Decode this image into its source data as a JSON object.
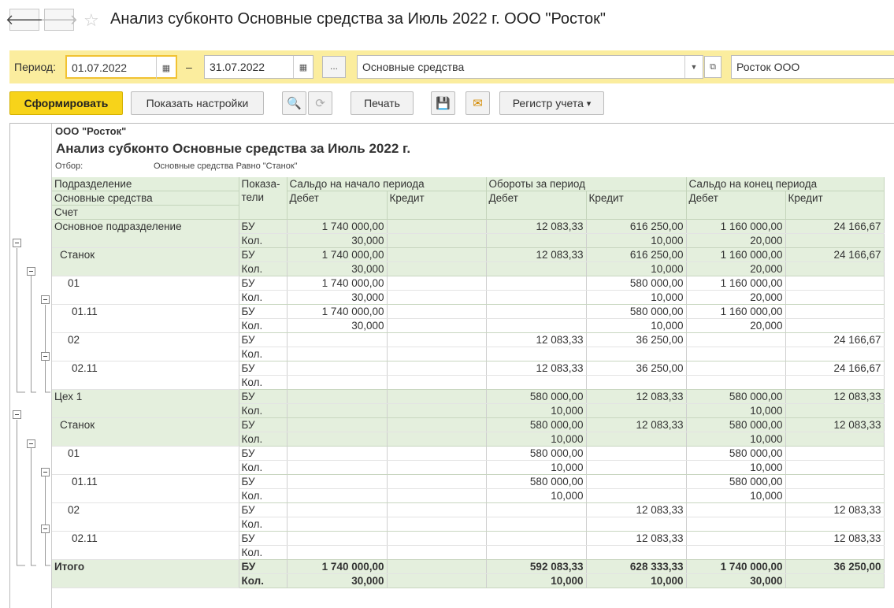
{
  "window": {
    "title": "Анализ субконто Основные средства за Июль 2022 г. ООО \"Росток\"",
    "back_icon": "arrow-left",
    "forward_icon": "arrow-right",
    "favorite_icon": "star"
  },
  "period": {
    "label": "Период:",
    "date_from": "01.07.2022",
    "dash": "–",
    "date_to": "31.07.2022",
    "dots_label": "...",
    "subconto": "Основные средства",
    "org": "Росток ООО"
  },
  "toolbar": {
    "generate": "Сформировать",
    "settings": "Показать настройки",
    "print": "Печать",
    "register": "Регистр учета",
    "register_arrow": "▾"
  },
  "report": {
    "org_name": "ООО \"Росток\"",
    "title": "Анализ субконто Основные средства за Июль 2022 г.",
    "filter_label": "Отбор:",
    "filter_value": "Основные средства Равно \"Станок\"",
    "headers": {
      "col1_line1": "Подразделение",
      "col1_line2": "Основные средства",
      "col1_line3": "Счет",
      "indicators_line1": "Показа-",
      "indicators_line2": "тели",
      "opening": "Сальдо на начало периода",
      "turnover": "Обороты за период",
      "closing": "Сальдо на конец периода",
      "debit": "Дебет",
      "credit": "Кредит"
    },
    "rows": [
      {
        "name": "Основное подразделение",
        "level": 0,
        "bu": [
          "1 740 000,00",
          "",
          "12 083,33",
          "616 250,00",
          "1 160 000,00",
          "24 166,67"
        ],
        "qty": [
          "30,000",
          "",
          "",
          "10,000",
          "20,000",
          ""
        ]
      },
      {
        "name": "Станок",
        "level": 1,
        "bu": [
          "1 740 000,00",
          "",
          "12 083,33",
          "616 250,00",
          "1 160 000,00",
          "24 166,67"
        ],
        "qty": [
          "30,000",
          "",
          "",
          "10,000",
          "20,000",
          ""
        ]
      },
      {
        "name": "01",
        "level": 2,
        "bu": [
          "1 740 000,00",
          "",
          "",
          "580 000,00",
          "1 160 000,00",
          ""
        ],
        "qty": [
          "30,000",
          "",
          "",
          "10,000",
          "20,000",
          ""
        ]
      },
      {
        "name": "01.11",
        "level": 3,
        "bu": [
          "1 740 000,00",
          "",
          "",
          "580 000,00",
          "1 160 000,00",
          ""
        ],
        "qty": [
          "30,000",
          "",
          "",
          "10,000",
          "20,000",
          ""
        ]
      },
      {
        "name": "02",
        "level": 2,
        "bu": [
          "",
          "",
          "12 083,33",
          "36 250,00",
          "",
          "24 166,67"
        ],
        "qty": [
          "",
          "",
          "",
          "",
          "",
          ""
        ]
      },
      {
        "name": "02.11",
        "level": 3,
        "bu": [
          "",
          "",
          "12 083,33",
          "36 250,00",
          "",
          "24 166,67"
        ],
        "qty": [
          "",
          "",
          "",
          "",
          "",
          ""
        ]
      },
      {
        "name": "Цех 1",
        "level": 0,
        "bu": [
          "",
          "",
          "580 000,00",
          "12 083,33",
          "580 000,00",
          "12 083,33"
        ],
        "qty": [
          "",
          "",
          "10,000",
          "",
          "10,000",
          ""
        ]
      },
      {
        "name": "Станок",
        "level": 1,
        "bu": [
          "",
          "",
          "580 000,00",
          "12 083,33",
          "580 000,00",
          "12 083,33"
        ],
        "qty": [
          "",
          "",
          "10,000",
          "",
          "10,000",
          ""
        ]
      },
      {
        "name": "01",
        "level": 2,
        "bu": [
          "",
          "",
          "580 000,00",
          "",
          "580 000,00",
          ""
        ],
        "qty": [
          "",
          "",
          "10,000",
          "",
          "10,000",
          ""
        ]
      },
      {
        "name": "01.11",
        "level": 3,
        "bu": [
          "",
          "",
          "580 000,00",
          "",
          "580 000,00",
          ""
        ],
        "qty": [
          "",
          "",
          "10,000",
          "",
          "10,000",
          ""
        ]
      },
      {
        "name": "02",
        "level": 2,
        "bu": [
          "",
          "",
          "",
          "12 083,33",
          "",
          "12 083,33"
        ],
        "qty": [
          "",
          "",
          "",
          "",
          "",
          ""
        ]
      },
      {
        "name": "02.11",
        "level": 3,
        "bu": [
          "",
          "",
          "",
          "12 083,33",
          "",
          "12 083,33"
        ],
        "qty": [
          "",
          "",
          "",
          "",
          "",
          ""
        ]
      }
    ],
    "indicator_bu": "БУ",
    "indicator_qty": "Кол.",
    "total": {
      "name": "Итого",
      "bu": [
        "1 740 000,00",
        "",
        "592 083,33",
        "628 333,33",
        "1 740 000,00",
        "36 250,00"
      ],
      "qty": [
        "30,000",
        "",
        "10,000",
        "10,000",
        "30,000",
        ""
      ]
    }
  },
  "colors": {
    "accent": "#f7d31a",
    "period_bar": "#fbed9e",
    "group_row": "#e4efdd"
  }
}
